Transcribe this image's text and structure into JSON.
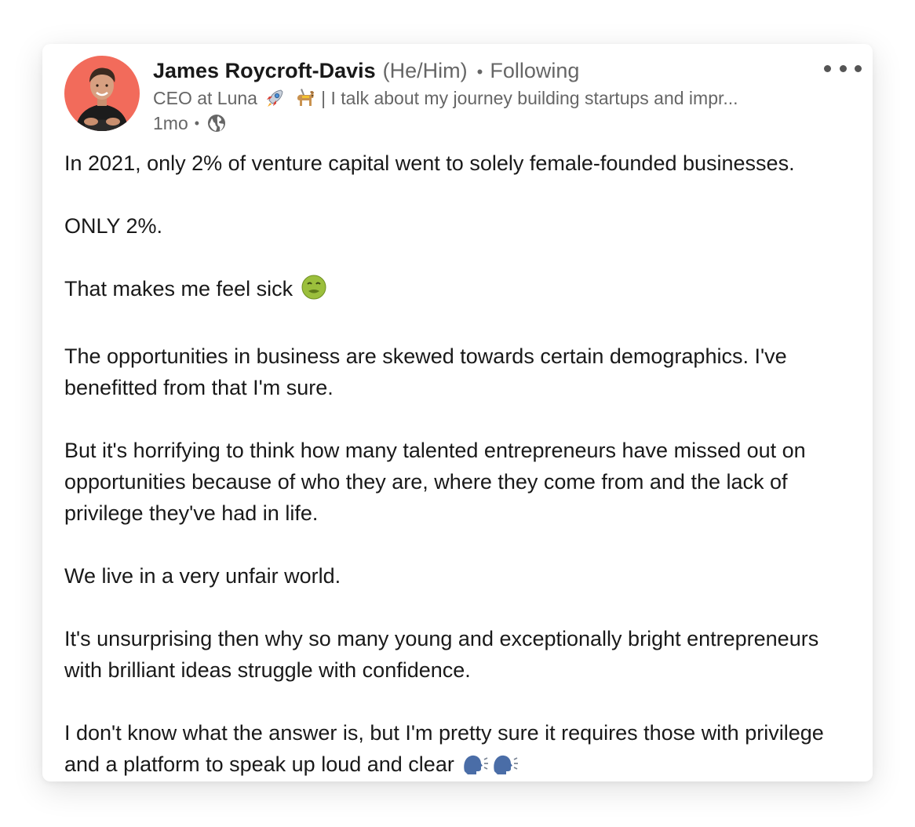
{
  "post": {
    "author": {
      "name": "James Roycroft-Davis",
      "pronouns": "(He/Him)",
      "separator": "•",
      "follow_status": "Following",
      "headline_prefix": "CEO at Luna",
      "headline_suffix": "| I talk about my journey building startups and impr...",
      "headline_emojis": [
        "rocket-emoji",
        "guide-dog-emoji"
      ],
      "age": "1mo",
      "visibility_icon": "globe-icon"
    },
    "more_icon": "more-horizontal-icon",
    "paragraphs": [
      "In 2021, only 2% of venture capital went to solely female-founded businesses.",
      "ONLY 2%.",
      "That makes me feel sick",
      "The opportunities in business are skewed towards certain demographics. I've benefitted from that I'm sure.",
      "But it's horrifying to think how many talented entrepreneurs have missed out on opportunities because of who they are, where they come from and the lack of privilege they've had in life.",
      "We live in a very unfair world.",
      "It's unsurprising then why so many young and exceptionally bright entrepreneurs with brilliant ideas struggle with confidence.",
      "I don't know what the answer is, but I'm pretty sure it requires those with privilege and a platform to speak up loud and clear"
    ],
    "inline_emojis": {
      "sick": "nauseated-face-emoji",
      "speak": [
        "speaking-head-emoji",
        "speaking-head-emoji"
      ]
    }
  },
  "colors": {
    "avatar_bg": "#f26b5b",
    "text_primary": "#191919",
    "text_secondary": "#666666"
  }
}
